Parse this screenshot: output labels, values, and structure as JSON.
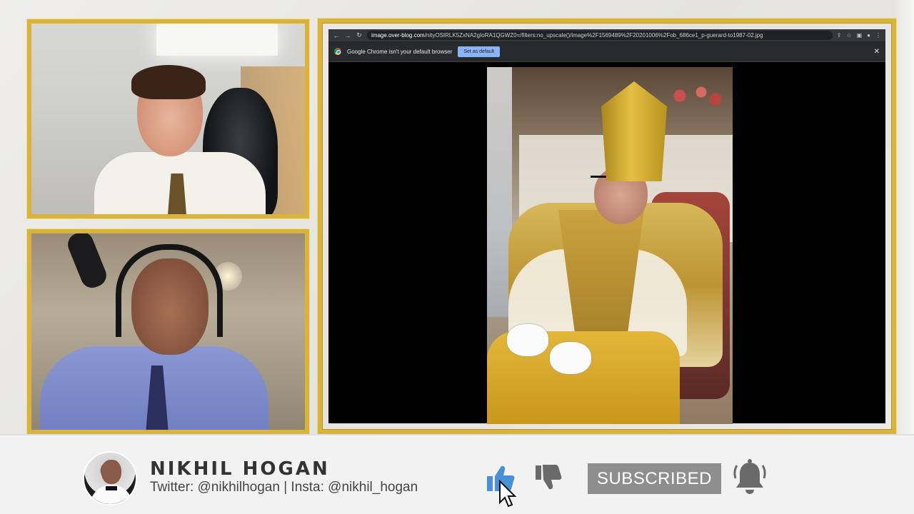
{
  "browser": {
    "url_host": "image.over-blog.com",
    "url_path": "/nityOSIRLK5ZxNA2gIoRA1QGWZ0=/filters:no_upscale()/image%2F1569489%2F20201006%2Fob_686ce1_p-guerard-to1987-02.jpg",
    "infobar_text": "Google Chrome isn't your default browser",
    "set_default_label": "Set as default",
    "close_label": "✕",
    "nav": {
      "back": "←",
      "forward": "→",
      "reload": "↻"
    },
    "toolbar_icons": [
      "⇪",
      "☆",
      "▣",
      "●",
      "⋮"
    ]
  },
  "overlay": {
    "channel_name": "NIKHIL HOGAN",
    "socials": "Twitter: @nikhilhogan | Insta: @nikhil_hogan",
    "subscribe_label": "SUBSCRIBED"
  },
  "colors": {
    "frame_gold": "#d8b43c",
    "like_blue": "#4a90d9",
    "subscribe_gray": "#8e8e8e",
    "icon_gray": "#6a6a6a"
  }
}
